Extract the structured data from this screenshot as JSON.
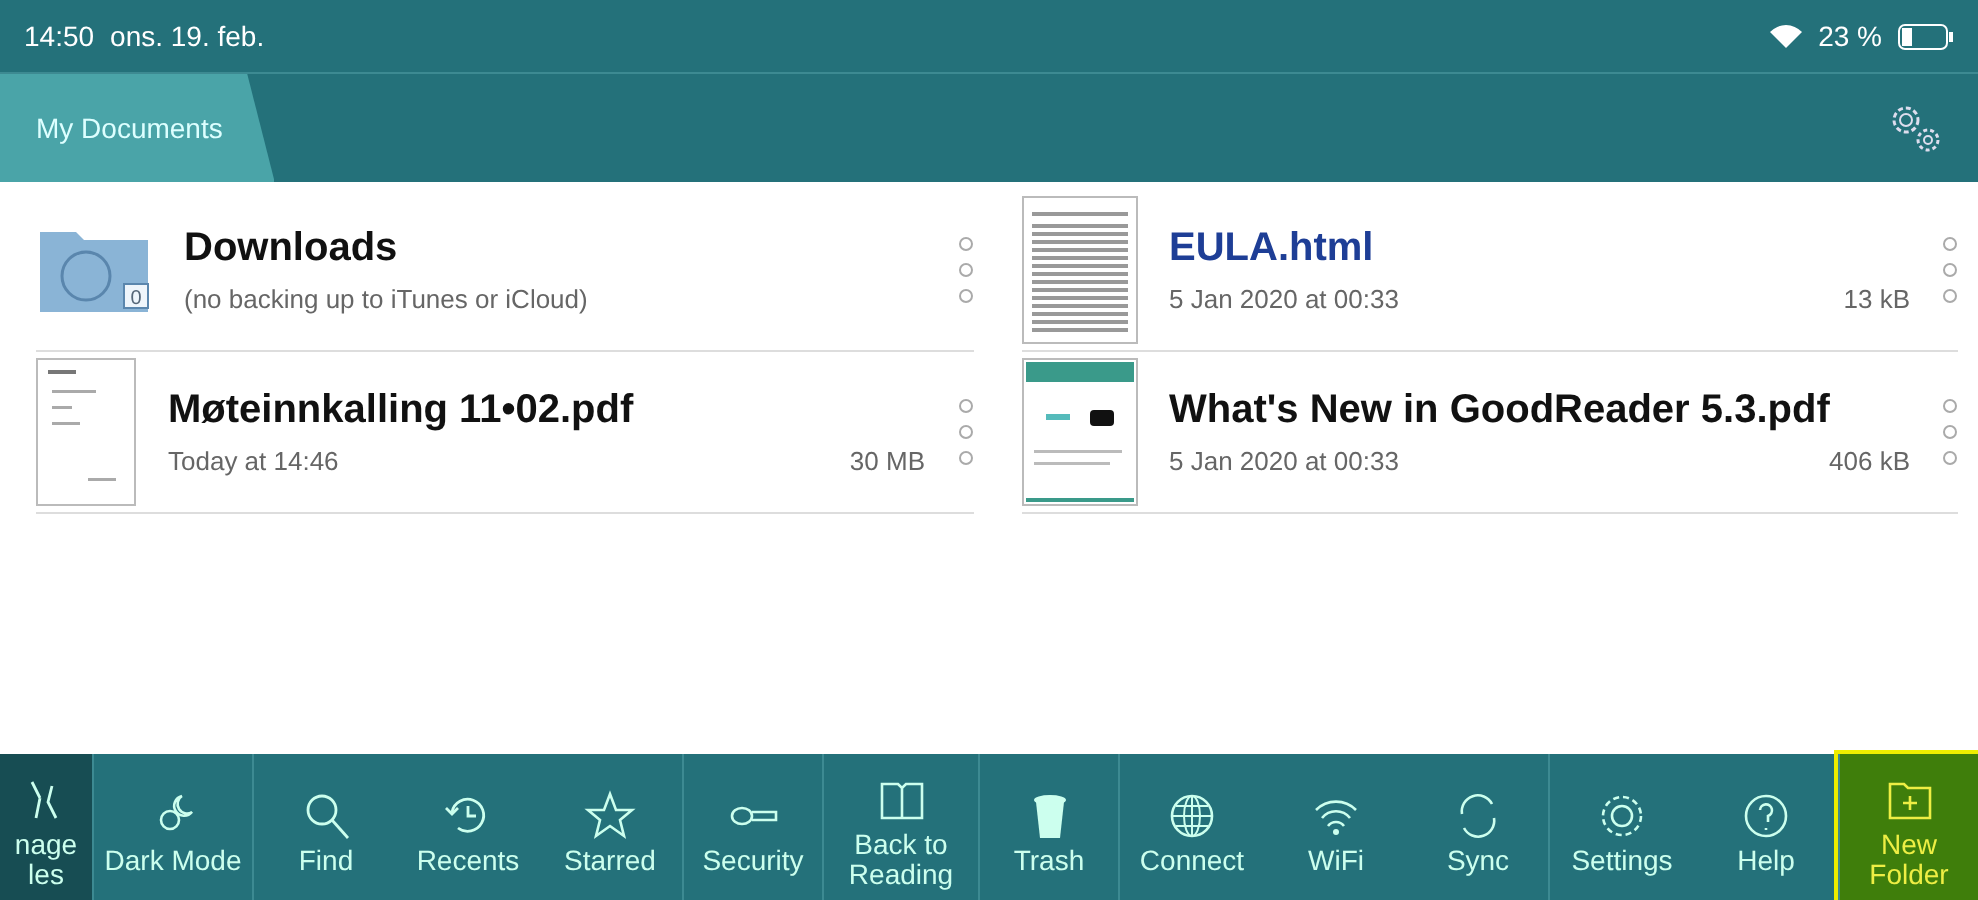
{
  "status_bar": {
    "time": "14:50",
    "date": "ons. 19. feb.",
    "battery": "23 %"
  },
  "tabs": [
    {
      "label": "My Documents",
      "selected": true
    }
  ],
  "files": [
    {
      "kind": "folder",
      "name": "Downloads",
      "detail": "(no backing up to iTunes or iCloud)",
      "badge": "0",
      "highlighted": false
    },
    {
      "kind": "text",
      "name": "EULA.html",
      "detail": "5 Jan 2020 at 00:33",
      "size": "13 kB",
      "highlighted": true
    },
    {
      "kind": "letter",
      "name": "Møteinnkalling 11•02.pdf",
      "detail": "Today at 14:46",
      "size": "30 MB",
      "highlighted": false
    },
    {
      "kind": "brochure",
      "name": "What's New in GoodReader 5.3.pdf",
      "detail": "5 Jan 2020 at 00:33",
      "size": "406 kB",
      "highlighted": false
    }
  ],
  "toolbar": [
    {
      "label": "nage les",
      "selected": true,
      "highlighted": false,
      "divider_before": false
    },
    {
      "label": "Dark Mode",
      "selected": false,
      "highlighted": false,
      "divider_before": true
    },
    {
      "label": "Find",
      "selected": false,
      "highlighted": false,
      "divider_before": true
    },
    {
      "label": "Recents",
      "selected": false,
      "highlighted": false,
      "divider_before": false
    },
    {
      "label": "Starred",
      "selected": false,
      "highlighted": false,
      "divider_before": false
    },
    {
      "label": "Security",
      "selected": false,
      "highlighted": false,
      "divider_before": true
    },
    {
      "label": "Back to Reading",
      "selected": false,
      "highlighted": false,
      "divider_before": true
    },
    {
      "label": "Trash",
      "selected": false,
      "highlighted": false,
      "divider_before": true
    },
    {
      "label": "Connect",
      "selected": false,
      "highlighted": false,
      "divider_before": true
    },
    {
      "label": "WiFi",
      "selected": false,
      "highlighted": false,
      "divider_before": false
    },
    {
      "label": "Sync",
      "selected": false,
      "highlighted": false,
      "divider_before": false
    },
    {
      "label": "Settings",
      "selected": false,
      "highlighted": false,
      "divider_before": true
    },
    {
      "label": "Help",
      "selected": false,
      "highlighted": false,
      "divider_before": false
    },
    {
      "label": "New Folder",
      "selected": false,
      "highlighted": true,
      "divider_before": true
    }
  ]
}
